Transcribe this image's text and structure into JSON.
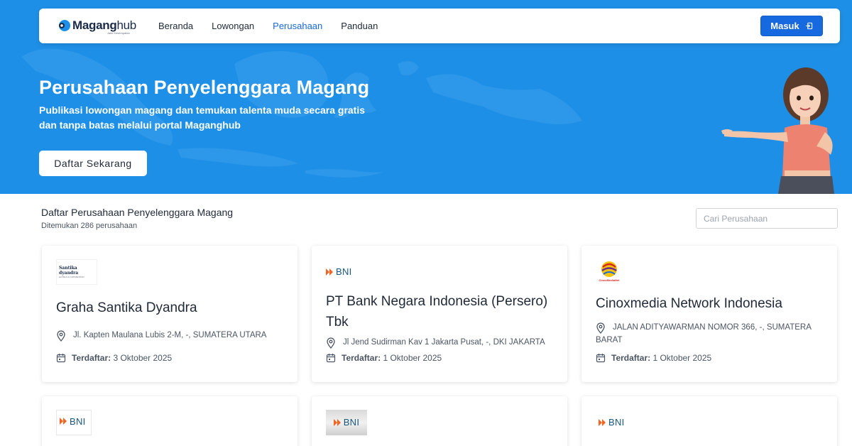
{
  "brand": {
    "name_bold": "Magang",
    "name_light": "hub",
    "sub": "Jalin Kesempatan"
  },
  "nav": {
    "items": [
      {
        "label": "Beranda"
      },
      {
        "label": "Lowongan"
      },
      {
        "label": "Perusahaan"
      },
      {
        "label": "Panduan"
      }
    ],
    "login_label": "Masuk"
  },
  "hero": {
    "title": "Perusahaan Penyelenggara Magang",
    "subtitle_line1": "Publikasi lowongan magang dan temukan talenta muda secara gratis",
    "subtitle_line2": "dan tanpa batas melalui portal Maganghub",
    "cta_label": "Daftar Sekarang"
  },
  "list": {
    "title": "Daftar Perusahaan Penyelenggara Magang",
    "count_text": "Ditemukan 286 perusahaan",
    "search_placeholder": "Cari Perusahaan"
  },
  "date_label": "Terdaftar:",
  "companies": [
    {
      "logo_text": "Santika dyandra",
      "logo_sub": "HOTELS & CONVENTION",
      "name": "Graha Santika Dyandra",
      "address": "Jl. Kapten Maulana Lubis 2-M, -, SUMATERA UTARA",
      "registered": "3 Oktober 2025"
    },
    {
      "logo_text": "BNI",
      "name": "PT Bank Negara Indonesia (Persero) Tbk",
      "address": "Jl Jend Sudirman Kav 1 Jakarta Pusat, -, DKI JAKARTA",
      "registered": "1 Oktober 2025"
    },
    {
      "logo_text": "CinoxMediaNet",
      "name": "Cinoxmedia Network Indonesia",
      "address": "JALAN ADITYAWARMAN NOMOR 366, -, SUMATERA BARAT",
      "registered": "1 Oktober 2025"
    },
    {
      "logo_text": "BNI"
    },
    {
      "logo_text": "BNI"
    },
    {
      "logo_text": "BNI"
    }
  ],
  "colors": {
    "hero_bg": "#1e8fe6",
    "primary": "#1769e0",
    "bni_orange": "#f26522",
    "bni_teal": "#17577e"
  },
  "icons": [
    "logo-mark-icon",
    "login-icon",
    "map-pin-icon",
    "calendar-icon"
  ]
}
